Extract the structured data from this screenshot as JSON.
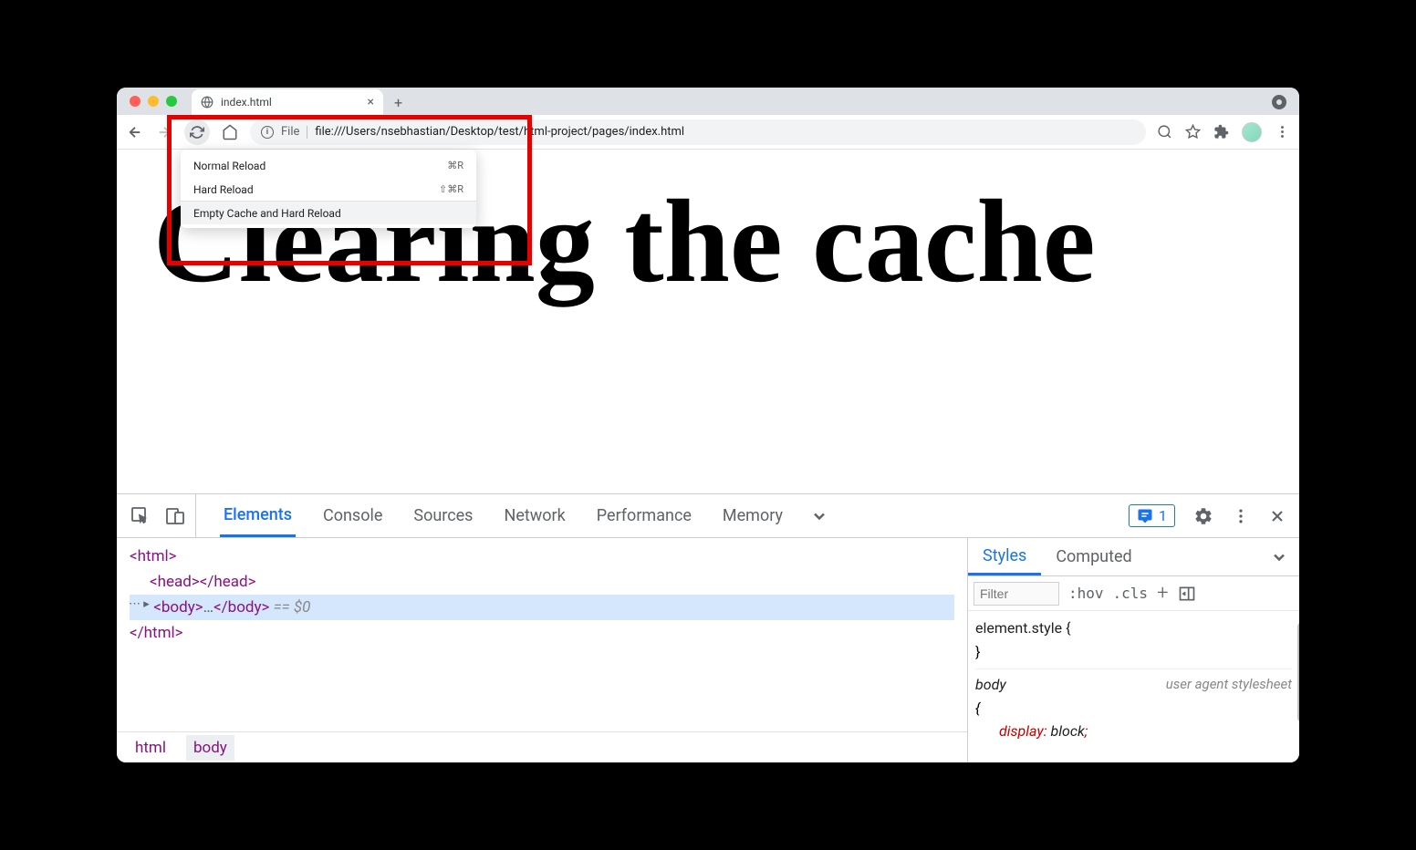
{
  "tab": {
    "title": "index.html"
  },
  "address": {
    "scheme": "File",
    "url": "file:///Users/nsebhastian/Desktop/test/html-project/pages/index.html"
  },
  "context_menu": {
    "items": [
      {
        "label": "Normal Reload",
        "shortcut": "⌘R"
      },
      {
        "label": "Hard Reload",
        "shortcut": "⇧⌘R"
      },
      {
        "label": "Empty Cache and Hard Reload",
        "shortcut": ""
      }
    ]
  },
  "page": {
    "heading": "Clearing the cache"
  },
  "devtools": {
    "tabs": [
      "Elements",
      "Console",
      "Sources",
      "Network",
      "Performance",
      "Memory"
    ],
    "issues_count": "1",
    "html_lines": {
      "open_html": "<html>",
      "head": "<head></head>",
      "body_open": "<body>",
      "body_ellipsis": "…",
      "body_close": "</body>",
      "dollar": " == $0",
      "close_html": "</html>"
    },
    "breadcrumb": [
      "html",
      "body"
    ],
    "styles": {
      "tabs": [
        "Styles",
        "Computed"
      ],
      "filter_placeholder": "Filter",
      "hov": ":hov",
      "cls": ".cls",
      "element_style": "element.style {",
      "close_brace": "}",
      "body_sel": "body",
      "ua_source": "user agent stylesheet",
      "open_brace": "{",
      "display_prop": "display",
      "display_val": "block"
    }
  }
}
